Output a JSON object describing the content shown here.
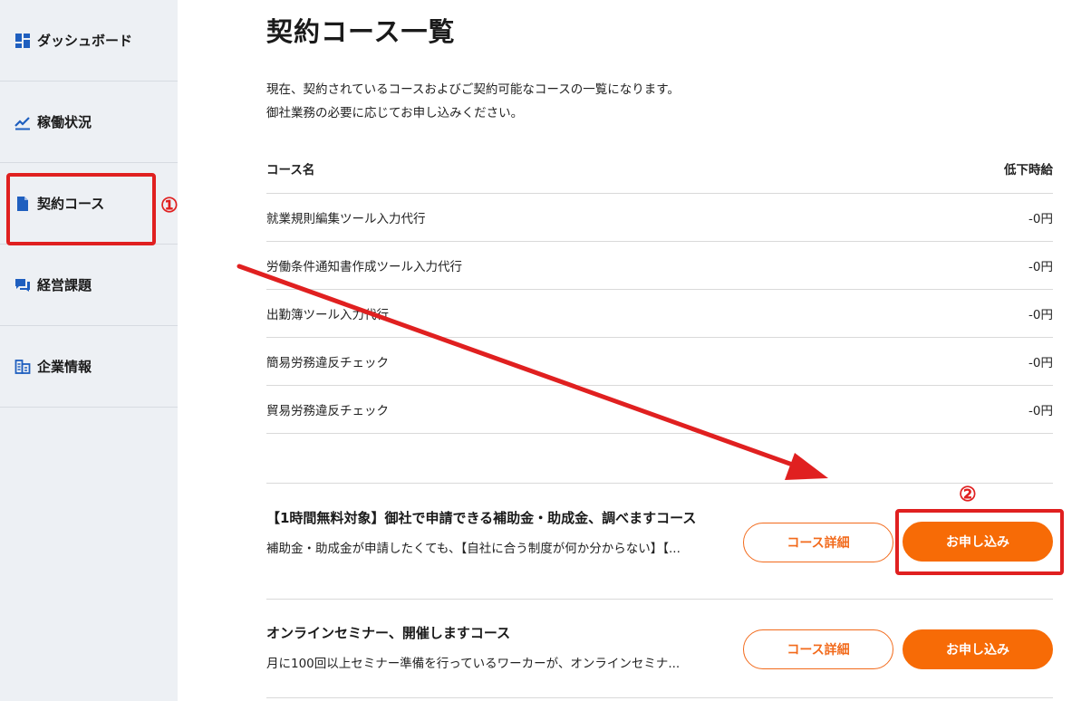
{
  "sidebar": {
    "items": [
      {
        "label": "ダッシュボード",
        "icon": "dashboard-icon"
      },
      {
        "label": "稼働状況",
        "icon": "trend-chart-icon"
      },
      {
        "label": "契約コース",
        "icon": "document-icon"
      },
      {
        "label": "経営課題",
        "icon": "chat-icon"
      },
      {
        "label": "企業情報",
        "icon": "building-icon"
      }
    ]
  },
  "page": {
    "title": "契約コース一覧",
    "intro_line1": "現在、契約されているコースおよびご契約可能なコースの一覧になります。",
    "intro_line2": "御社業務の必要に応じてお申し込みください。"
  },
  "table": {
    "headers": {
      "name": "コース名",
      "price": "低下時給"
    },
    "rows": [
      {
        "name": "就業規則編集ツール入力代行",
        "price": "-0円"
      },
      {
        "name": "労働条件通知書作成ツール入力代行",
        "price": "-0円"
      },
      {
        "name": "出勤簿ツール入力代行",
        "price": "-0円"
      },
      {
        "name": "簡易労務違反チェック",
        "price": "-0円"
      },
      {
        "name": "貿易労務違反チェック",
        "price": "-0円"
      }
    ]
  },
  "courses": [
    {
      "title": "【1時間無料対象】御社で申請できる補助金・助成金、調べますコース",
      "description": "補助金・助成金が申請したくても、【自社に合う制度が何か分からない】【...",
      "detail_label": "コース詳細",
      "apply_label": "お申し込み"
    },
    {
      "title": "オンラインセミナー、開催しますコース",
      "description": "月に100回以上セミナー準備を行っているワーカーが、オンラインセミナ...",
      "detail_label": "コース詳細",
      "apply_label": "お申し込み"
    }
  ],
  "annotations": {
    "step1": "①",
    "step2": "②",
    "color": "#e02020"
  },
  "colors": {
    "accent": "#f76b06",
    "sidebar_bg": "#edf0f4"
  }
}
